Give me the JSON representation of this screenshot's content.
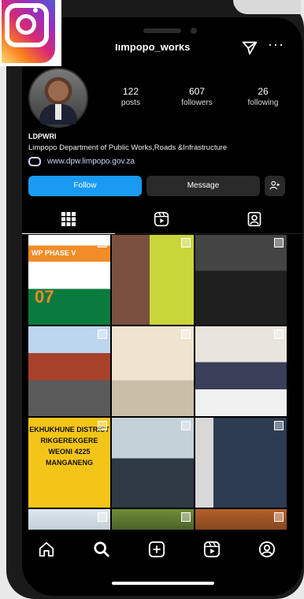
{
  "profile": {
    "username": "limpopo_works",
    "stats": [
      {
        "number": "122",
        "label": "posts"
      },
      {
        "number": "607",
        "label": "followers"
      },
      {
        "number": "26",
        "label": "following"
      }
    ],
    "bio_name": "LDPWRI",
    "bio_description": "Limpopo Department of Public Works,Roads &Infrastructure",
    "bio_link": "www.dpw.limpopo.gov.za"
  },
  "buttons": {
    "follow": "Follow",
    "message": "Message"
  },
  "posts": [
    {
      "overlay_title": "WP PHASE V",
      "overlay_big": "07"
    },
    {},
    {},
    {},
    {},
    {},
    {
      "overlay_text": "EKHUKHUNE DISTRICT RIKGEREKGERE WEONI 4225 MANGANENG"
    },
    {},
    {},
    {},
    {},
    {}
  ],
  "colors": {
    "follow_button": "#1a9af2",
    "background": "#000000"
  },
  "icons": [
    "instagram-logo",
    "send-icon",
    "more-icon",
    "link-icon",
    "add-user-icon",
    "grid-icon",
    "reels-icon",
    "tagged-icon",
    "home-icon",
    "search-icon",
    "create-icon",
    "reels-nav-icon",
    "profile-icon"
  ]
}
